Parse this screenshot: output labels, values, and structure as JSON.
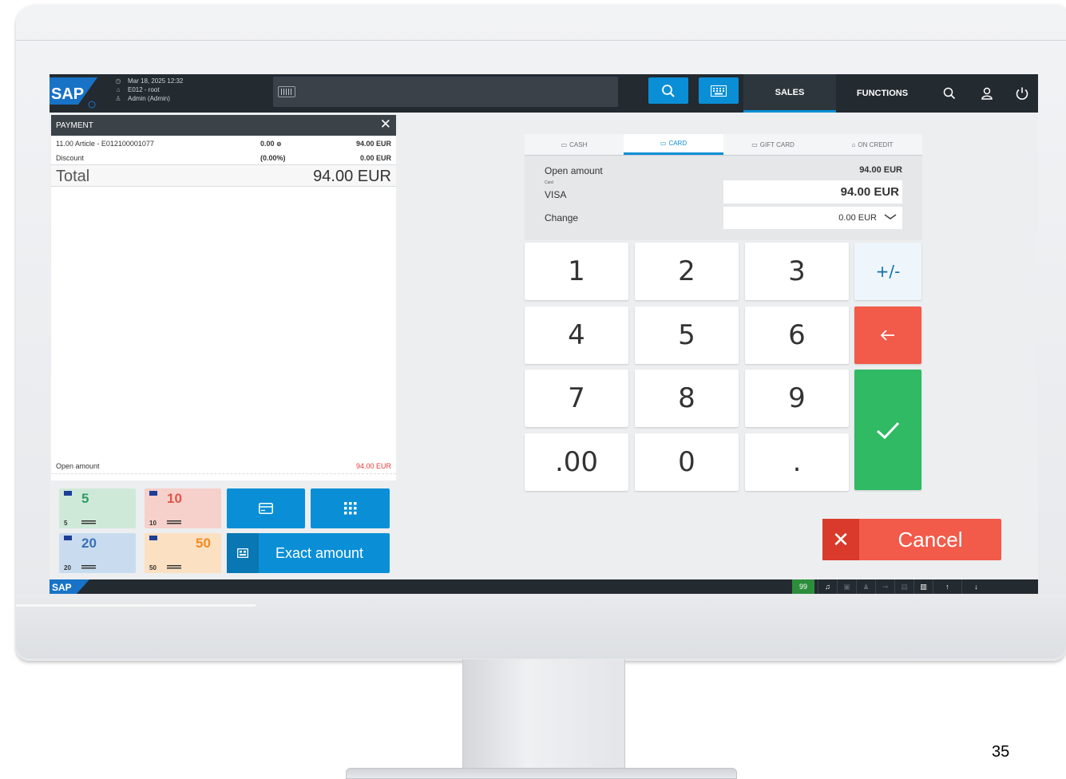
{
  "header": {
    "datetime": "Mar 18, 2025 12:32",
    "store": "E012 - root",
    "user": "Admin (Admin)",
    "nav_sales": "SALES",
    "nav_functions": "FUNCTIONS"
  },
  "payment_panel": {
    "title": "PAYMENT",
    "lines": [
      {
        "label": "11.00 Article - E012100001077",
        "qty": "0.00",
        "amount": "94.00 EUR"
      },
      {
        "label": "Discount",
        "qty": "(0.00%)",
        "amount": "0.00 EUR"
      }
    ],
    "total_label": "Total",
    "total_value": "94.00 EUR",
    "open_amount_label": "Open amount",
    "open_amount_value": "94.00 EUR"
  },
  "quick_buttons": {
    "notes": [
      {
        "value": "5",
        "small": "5",
        "color": "#cfe9d9",
        "text_color": "#2f9e61"
      },
      {
        "value": "10",
        "small": "10",
        "color": "#f6d0ca",
        "text_color": "#e0554a"
      },
      {
        "value": "20",
        "small": "20",
        "color": "#c9dcef",
        "text_color": "#3a6fb5"
      },
      {
        "value": "50",
        "small": "50",
        "color": "#fbe0c2",
        "text_color": "#ef8c22"
      }
    ],
    "exact_amount": "Exact amount"
  },
  "tender_tabs": [
    {
      "label": "CASH",
      "active": false
    },
    {
      "label": "CARD",
      "active": true
    },
    {
      "label": "GIFT CARD",
      "active": false
    },
    {
      "label": "ON CREDIT",
      "active": false
    }
  ],
  "amounts": {
    "open_amount_label": "Open amount",
    "open_amount_value": "94.00 EUR",
    "card_caption": "Card",
    "card_type": "VISA",
    "card_value": "94.00 EUR",
    "change_label": "Change",
    "change_value": "0.00 EUR"
  },
  "keypad": {
    "keys": [
      "1",
      "2",
      "3",
      "4",
      "5",
      "6",
      "7",
      "8",
      "9",
      ".00",
      "0",
      "."
    ],
    "plus_minus": "+/-"
  },
  "cancel_label": "Cancel",
  "status_bar": {
    "count": "99"
  },
  "slide_number": "35",
  "colors": {
    "accent": "#0a8fd6",
    "confirm": "#2fba63",
    "danger": "#f25a4a",
    "dark_bar": "#232a30"
  }
}
